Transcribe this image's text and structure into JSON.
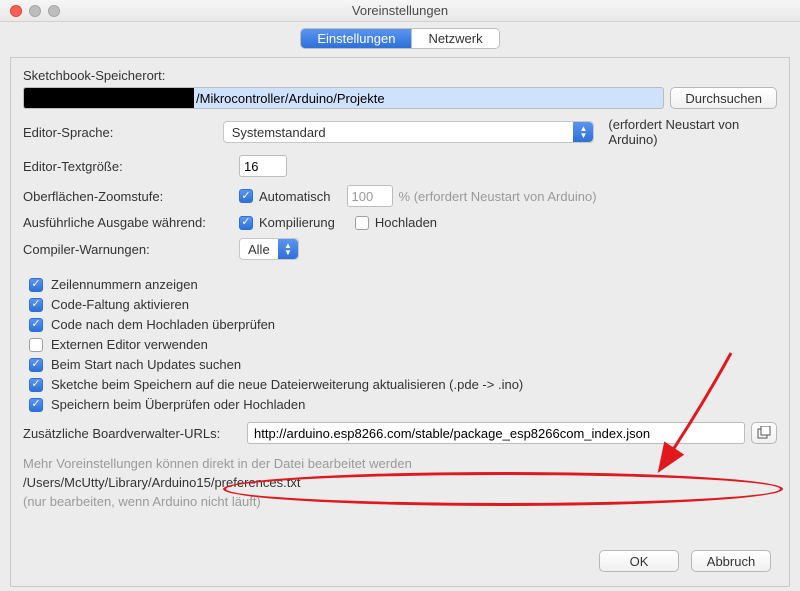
{
  "window": {
    "title": "Voreinstellungen"
  },
  "tabs": {
    "settings": "Einstellungen",
    "network": "Netzwerk"
  },
  "labels": {
    "sketchbook": "Sketchbook-Speicherort:",
    "browse": "Durchsuchen",
    "sketchbook_path_visible": "/Mikrocontroller/Arduino/Projekte",
    "editor_language": "Editor-Sprache:",
    "language_value": "Systemstandard",
    "restart_required": "(erfordert Neustart von Arduino)",
    "editor_textsize": "Editor-Textgröße:",
    "textsize_value": "16",
    "zoom_label": "Oberflächen-Zoomstufe:",
    "zoom_auto": "Automatisch",
    "zoom_value": "100",
    "zoom_pct_hint": "%  (erfordert Neustart von Arduino)",
    "verbose_label": "Ausführliche Ausgabe während:",
    "verbose_compile": "Kompilierung",
    "verbose_upload": "Hochladen",
    "compiler_warnings": "Compiler-Warnungen:",
    "warnings_value": "Alle",
    "cb_linenumbers": "Zeilennummern anzeigen",
    "cb_folding": "Code-Faltung aktivieren",
    "cb_verify_upload": "Code nach dem Hochladen überprüfen",
    "cb_external_editor": "Externen Editor verwenden",
    "cb_check_updates": "Beim Start nach Updates suchen",
    "cb_update_ext": "Sketche beim Speichern auf die neue Dateierweiterung aktualisieren (.pde -> .ino)",
    "cb_save_verify": "Speichern beim Überprüfen oder Hochladen",
    "boards_url_label": "Zusätzliche Boardverwalter-URLs:",
    "boards_url_value": "http://arduino.esp8266.com/stable/package_esp8266com_index.json",
    "more_prefs_hint": "Mehr Voreinstellungen können direkt in der Datei bearbeitet werden",
    "prefs_path": "/Users/McUtty/Library/Arduino15/preferences.txt",
    "edit_only_hint": "(nur bearbeiten, wenn Arduino nicht läuft)",
    "ok": "OK",
    "cancel": "Abbruch"
  }
}
